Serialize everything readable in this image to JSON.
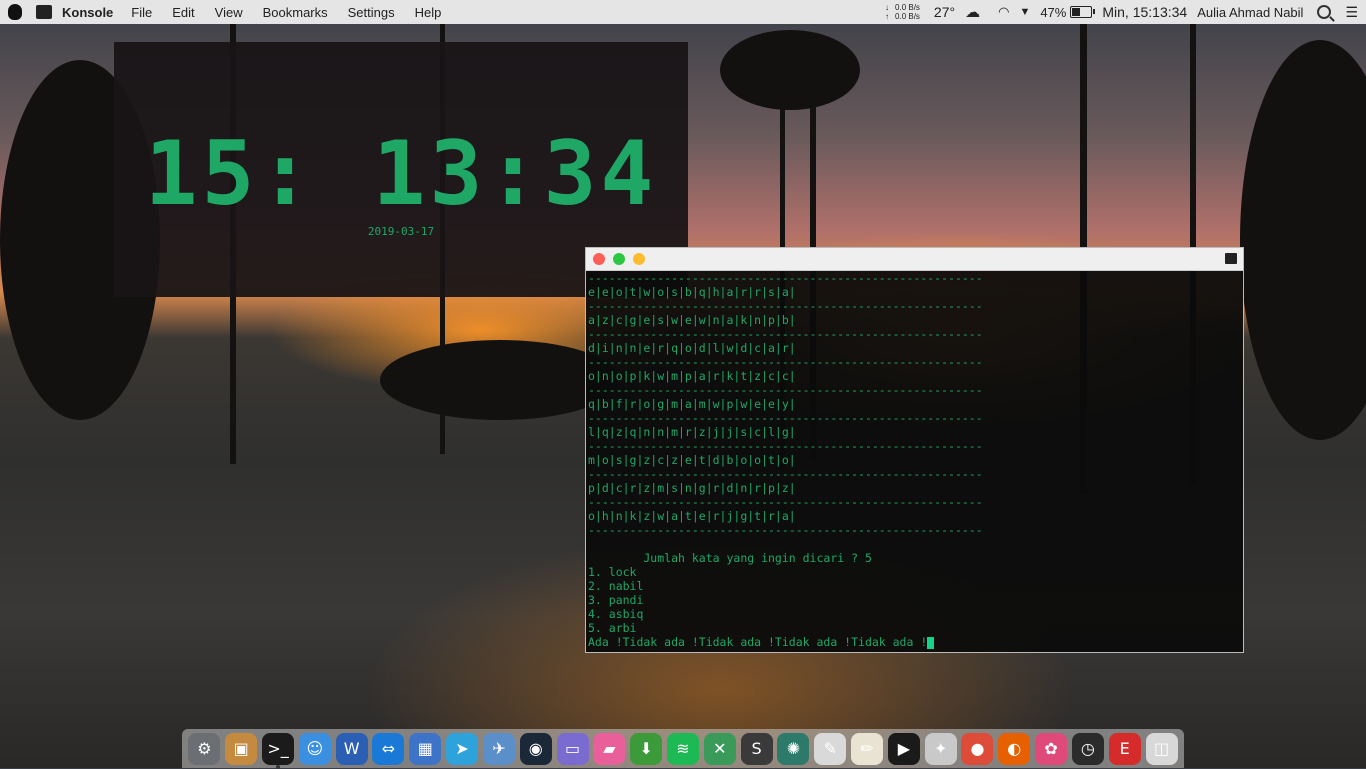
{
  "menubar": {
    "app_name": "Konsole",
    "menus": [
      "File",
      "Edit",
      "View",
      "Bookmarks",
      "Settings",
      "Help"
    ],
    "net_down": "0.0 B/s",
    "net_up": "0.0 B/s",
    "temperature": "27°",
    "battery": "47%",
    "battery_level": 0.47,
    "datetime": "Min, 15:13:34",
    "user": "Aulia Ahmad Nabil"
  },
  "clock": {
    "time": "15: 13:34",
    "date": "2019-03-17"
  },
  "terminal": {
    "lines": [
      "---------------------------------------------------------",
      "e|e|o|t|w|o|s|b|q|h|a|r|r|s|a|",
      "---------------------------------------------------------",
      "a|z|c|g|e|s|w|e|w|n|a|k|n|p|b|",
      "---------------------------------------------------------",
      "d|i|n|n|e|r|q|o|d|l|w|d|c|a|r|",
      "---------------------------------------------------------",
      "o|n|o|p|k|w|m|p|a|r|k|t|z|c|c|",
      "---------------------------------------------------------",
      "q|b|f|r|o|g|m|a|m|w|p|w|e|e|y|",
      "---------------------------------------------------------",
      "l|q|z|q|n|n|m|r|z|j|j|s|c|l|g|",
      "---------------------------------------------------------",
      "m|o|s|g|z|c|z|e|t|d|b|o|o|t|o|",
      "---------------------------------------------------------",
      "p|d|c|r|z|m|s|n|g|r|d|n|r|p|z|",
      "---------------------------------------------------------",
      "o|h|n|k|z|w|a|t|e|r|j|g|t|r|a|",
      "---------------------------------------------------------",
      "",
      "        Jumlah kata yang ingin dicari ? 5",
      "1. lock",
      "2. nabil",
      "3. pandi",
      "4. asbiq",
      "5. arbi",
      "Ada !Tidak ada !Tidak ada !Tidak ada !Tidak ada !"
    ]
  },
  "dock": {
    "items": [
      {
        "name": "system-preferences-icon",
        "color": "#6b6e73",
        "glyph": "⚙"
      },
      {
        "name": "archive-utility-icon",
        "color": "#c48a3f",
        "glyph": "▣"
      },
      {
        "name": "terminal-icon",
        "color": "#1b1b1b",
        "glyph": ">_"
      },
      {
        "name": "finder-icon",
        "color": "#3a8fe0",
        "glyph": "☺"
      },
      {
        "name": "word-icon",
        "color": "#2b5fb4",
        "glyph": "W"
      },
      {
        "name": "teamviewer-icon",
        "color": "#1a78d6",
        "glyph": "⇔"
      },
      {
        "name": "app-grid-icon",
        "color": "#3e74c8",
        "glyph": "▦"
      },
      {
        "name": "telegram-icon",
        "color": "#2ea2db",
        "glyph": "➤"
      },
      {
        "name": "preview-icon",
        "color": "#5b8fc9",
        "glyph": "✈"
      },
      {
        "name": "steam-icon",
        "color": "#1b2838",
        "glyph": "◉"
      },
      {
        "name": "gameboy-icon",
        "color": "#7a6bd1",
        "glyph": "▭"
      },
      {
        "name": "folder-pink-icon",
        "color": "#e85f9a",
        "glyph": "▰"
      },
      {
        "name": "download-icon",
        "color": "#3d9a3a",
        "glyph": "⬇"
      },
      {
        "name": "spotify-icon",
        "color": "#1db954",
        "glyph": "≋"
      },
      {
        "name": "xcode-icon",
        "color": "#3a9a5a",
        "glyph": "✕"
      },
      {
        "name": "sublime-icon",
        "color": "#3a3a3a",
        "glyph": "S"
      },
      {
        "name": "pineapple-icon",
        "color": "#2d7a6a",
        "glyph": "✺"
      },
      {
        "name": "text-edit-icon",
        "color": "#d9d9d9",
        "glyph": "✎"
      },
      {
        "name": "notes-icon",
        "color": "#e8e3d3",
        "glyph": "✏"
      },
      {
        "name": "play-icon",
        "color": "#1a1a1a",
        "glyph": "▶"
      },
      {
        "name": "preferences-icon",
        "color": "#c9c9c9",
        "glyph": "✦"
      },
      {
        "name": "chrome-icon",
        "color": "#dd4b39",
        "glyph": "●"
      },
      {
        "name": "firefox-icon",
        "color": "#e66000",
        "glyph": "◐"
      },
      {
        "name": "photos-icon",
        "color": "#e04a7a",
        "glyph": "✿"
      },
      {
        "name": "dashboard-icon",
        "color": "#2b2b2b",
        "glyph": "◷"
      },
      {
        "name": "ascii-app-icon",
        "color": "#d62b2b",
        "glyph": "E"
      },
      {
        "name": "photo-booth-icon",
        "color": "#d8d8d8",
        "glyph": "◫"
      }
    ]
  }
}
